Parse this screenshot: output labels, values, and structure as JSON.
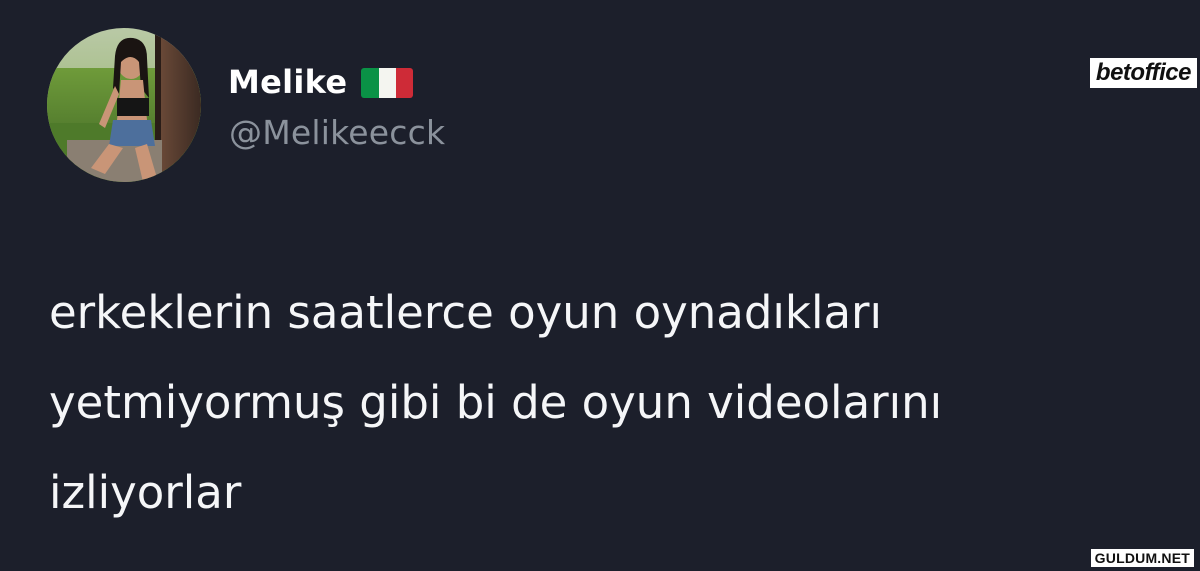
{
  "tweet": {
    "author": {
      "display_name": "Melike",
      "flag_icon": "italy-flag-icon",
      "handle": "@Melikeecck",
      "avatar_icon": "profile-photo"
    },
    "text_lines": [
      "erkeklerin saatlerce oyun oynadıkları",
      "yetmiyormuş gibi bi de oyun videolarını",
      "izliyorlar"
    ]
  },
  "watermarks": {
    "top_right": "betoffice",
    "bottom_right": "GULDUM.NET"
  },
  "colors": {
    "background": "#1c1f2b",
    "name": "#ffffff",
    "handle": "#8b929c",
    "body_text": "#f5f6f8",
    "flag_green": "#0a9246",
    "flag_white": "#f4f5f0",
    "flag_red": "#ce2b37"
  }
}
